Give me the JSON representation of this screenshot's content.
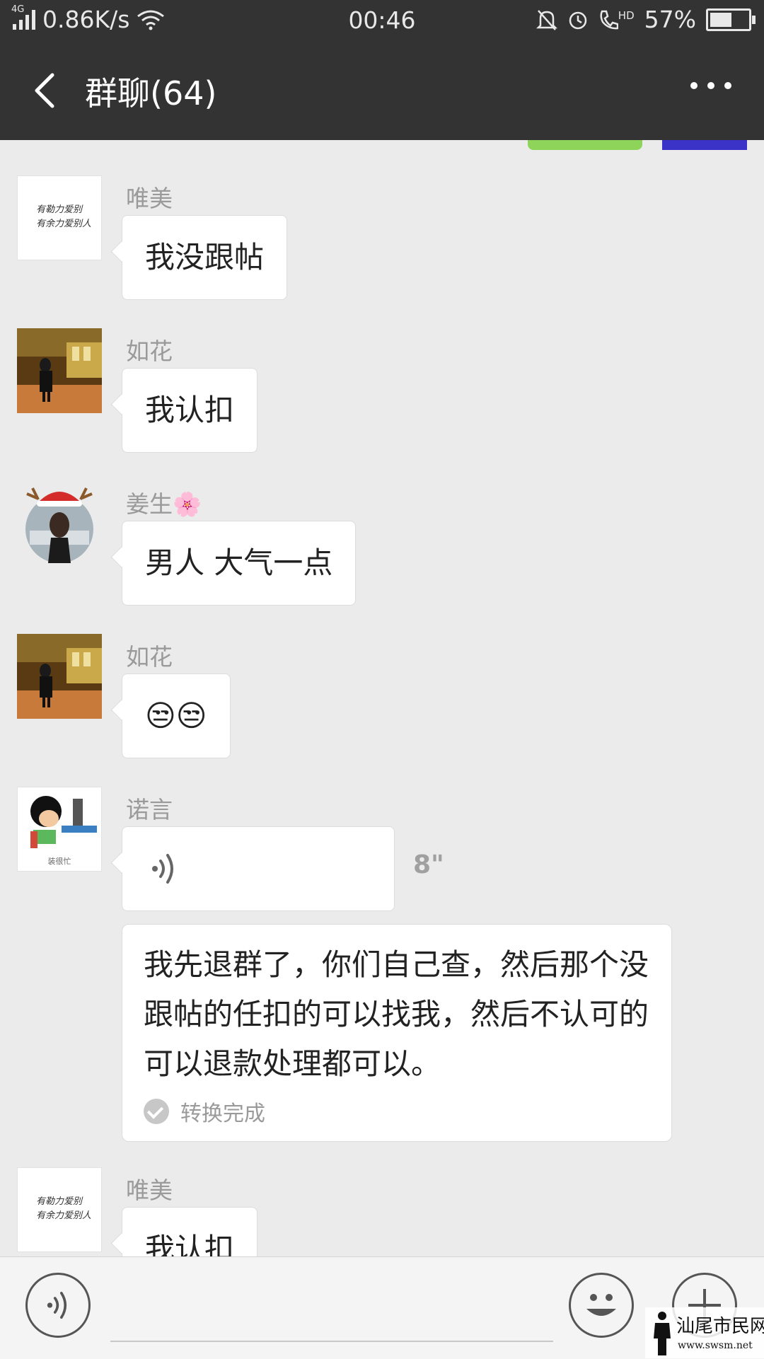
{
  "status_bar": {
    "network_type": "4G",
    "speed": "0.86K/s",
    "time": "00:46",
    "hd_label": "HD",
    "battery_percent": "57%",
    "battery_level": 0.57
  },
  "header": {
    "title": "群聊(64)"
  },
  "messages": [
    {
      "sender": "唯美",
      "text": "我没跟帖",
      "avatar": "calligraphy-avatar"
    },
    {
      "sender": "如花",
      "text": "我认扣",
      "avatar": "station-avatar"
    },
    {
      "sender": "姜生🌸",
      "text": "男人 大气一点",
      "avatar": "christmas-hat-avatar"
    },
    {
      "sender": "如花",
      "text": "😒😒",
      "avatar": "station-avatar"
    },
    {
      "sender": "诺言",
      "voice_duration": "8\"",
      "avatar": "cartoon-avatar",
      "avatar_caption": "装很忙",
      "transcript": "我先退群了，你们自己查，然后那个没跟帖的任扣的可以找我，然后不认可的可以退款处理都可以。",
      "transcript_status": "转换完成"
    },
    {
      "sender": "唯美",
      "text": "我认扣",
      "avatar": "calligraphy-avatar"
    }
  ],
  "avatar_calligraphy_text": [
    "有勒力爱别",
    "有余力爱别人"
  ],
  "watermark": {
    "name": "汕尾市民网",
    "url": "www.swsm.net"
  },
  "icons": {
    "back": "chevron-left-icon",
    "more": "more-dots-icon",
    "voice": "voice-wave-icon",
    "emoji": "emoji-icon",
    "plus": "plus-icon"
  }
}
